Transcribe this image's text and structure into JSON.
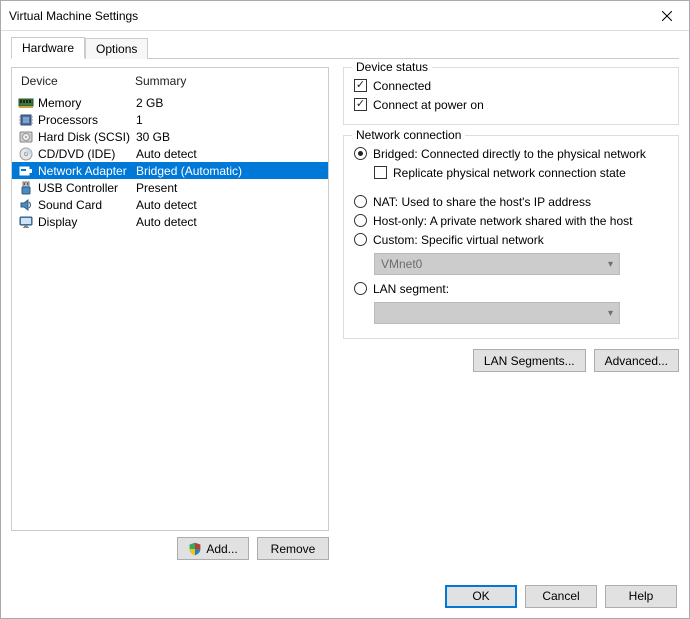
{
  "window": {
    "title": "Virtual Machine Settings"
  },
  "tabs": {
    "hardware": "Hardware",
    "options": "Options",
    "active": "hardware"
  },
  "list": {
    "header_device": "Device",
    "header_summary": "Summary",
    "items": [
      {
        "icon": "memory",
        "name": "Memory",
        "summary": "2 GB"
      },
      {
        "icon": "cpu",
        "name": "Processors",
        "summary": "1"
      },
      {
        "icon": "hdd",
        "name": "Hard Disk (SCSI)",
        "summary": "30 GB"
      },
      {
        "icon": "cd",
        "name": "CD/DVD (IDE)",
        "summary": "Auto detect"
      },
      {
        "icon": "nic",
        "name": "Network Adapter",
        "summary": "Bridged (Automatic)"
      },
      {
        "icon": "usb",
        "name": "USB Controller",
        "summary": "Present"
      },
      {
        "icon": "sound",
        "name": "Sound Card",
        "summary": "Auto detect"
      },
      {
        "icon": "display",
        "name": "Display",
        "summary": "Auto detect"
      }
    ],
    "selected_index": 4
  },
  "left_buttons": {
    "add": "Add...",
    "remove": "Remove"
  },
  "status": {
    "legend": "Device status",
    "connected_label": "Connected",
    "connected": true,
    "connect_poweron_label": "Connect at power on",
    "connect_poweron": true
  },
  "netconn": {
    "legend": "Network connection",
    "bridged_label": "Bridged: Connected directly to the physical network",
    "replicate_label": "Replicate physical network connection state",
    "replicate": false,
    "nat_label": "NAT: Used to share the host's IP address",
    "hostonly_label": "Host-only: A private network shared with the host",
    "custom_label": "Custom: Specific virtual network",
    "custom_value": "VMnet0",
    "lanseg_label": "LAN segment:",
    "lanseg_value": "",
    "selected": "bridged"
  },
  "right_buttons": {
    "lansegments": "LAN Segments...",
    "advanced": "Advanced..."
  },
  "footer": {
    "ok": "OK",
    "cancel": "Cancel",
    "help": "Help"
  }
}
